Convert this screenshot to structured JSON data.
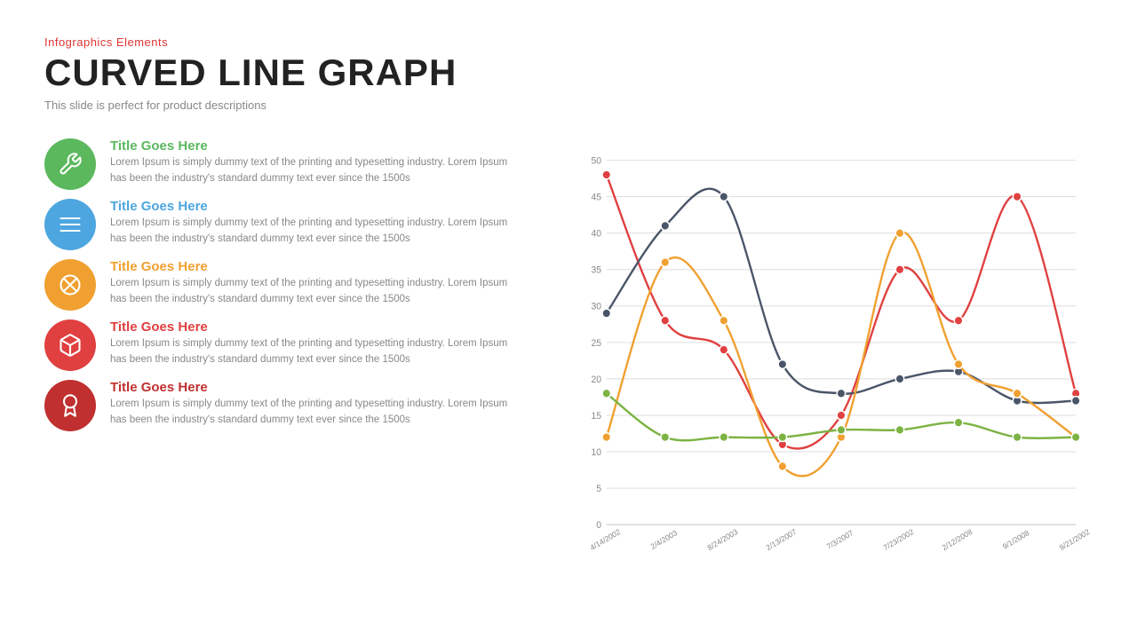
{
  "header": {
    "tag": "Infographics  Elements",
    "title": "CURVED LINE GRAPH",
    "description": "This slide is perfect for product descriptions"
  },
  "items": [
    {
      "id": 1,
      "color": "green",
      "iconType": "wrench",
      "title": "Title Goes Here",
      "body": "Lorem Ipsum is simply dummy text of the printing and typesetting industry. Lorem Ipsum has been the industry's standard dummy text ever since the 1500s"
    },
    {
      "id": 2,
      "color": "blue",
      "iconType": "burger",
      "title": "Title Goes Here",
      "body": "Lorem Ipsum is simply dummy text of the printing and typesetting industry. Lorem Ipsum has been the industry's standard dummy text ever since the 1500s"
    },
    {
      "id": 3,
      "color": "orange",
      "iconType": "cross",
      "title": "Title Goes Here",
      "body": "Lorem Ipsum is simply dummy text of the printing and typesetting industry. Lorem Ipsum has been the industry's standard dummy text ever since the 1500s"
    },
    {
      "id": 4,
      "color": "red",
      "iconType": "cube",
      "title": "Title Goes Here",
      "body": "Lorem Ipsum is simply dummy text of the printing and typesetting industry. Lorem Ipsum has been the industry's standard dummy text ever since the 1500s"
    },
    {
      "id": 5,
      "color": "darkred",
      "iconType": "badge",
      "title": "Title Goes Here",
      "body": "Lorem Ipsum is simply dummy text of the printing and typesetting industry. Lorem Ipsum has been the industry's standard dummy text ever since the 1500s"
    }
  ],
  "chart": {
    "yMax": 50,
    "yStep": 5,
    "xLabels": [
      "4/14/2002",
      "2/4/2003",
      "8/24/2003",
      "2/13/2007",
      "7/3/2007",
      "7/23/2002",
      "2/12/2008",
      "9/1/2008",
      "9/21/2002"
    ],
    "series": [
      {
        "color": "#e04040",
        "points": [
          48,
          28,
          24,
          11,
          15,
          35,
          28,
          45,
          18
        ]
      },
      {
        "color": "#4a5568",
        "points": [
          29,
          41,
          45,
          22,
          18,
          20,
          21,
          17,
          17
        ]
      },
      {
        "color": "#f0a030",
        "points": [
          12,
          36,
          28,
          8,
          12,
          40,
          22,
          18,
          12
        ]
      },
      {
        "color": "#7cb342",
        "points": [
          18,
          12,
          12,
          12,
          13,
          13,
          14,
          12,
          12
        ]
      }
    ]
  }
}
